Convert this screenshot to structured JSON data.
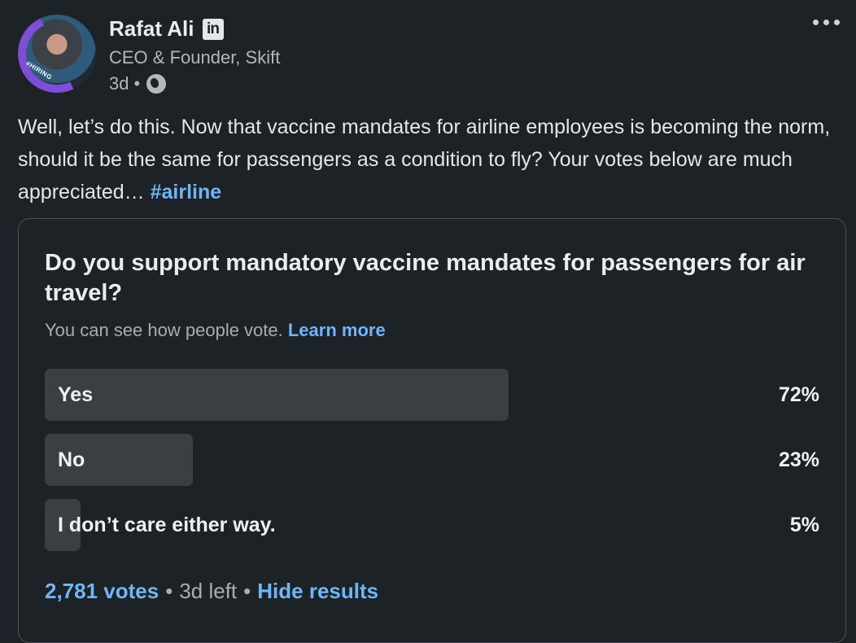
{
  "author": {
    "name": "Rafat Ali",
    "badge": "in",
    "headline": "CEO & Founder, Skift",
    "time": "3d",
    "dot": "•",
    "avatar_tag": "#HIRING"
  },
  "post": {
    "text": "Well, let’s do this. Now that vaccine mandates for airline employees is becoming the norm, should it be the same for passengers as a condition to fly? Your votes below are much appreciated… ",
    "hashtag": "#airline"
  },
  "poll": {
    "question": "Do you support mandatory vaccine mandates for passengers for air travel?",
    "notice": "You can see how people vote. ",
    "learn_more": "Learn more",
    "options": [
      {
        "label": "Yes",
        "percent": "72%",
        "fraction": 0.72
      },
      {
        "label": "No",
        "percent": "23%",
        "fraction": 0.23
      },
      {
        "label": "I don’t care either way.",
        "percent": "5%",
        "fraction": 0.05
      }
    ],
    "votes": "2,781 votes",
    "time_left": "3d left",
    "hide_results": "Hide results",
    "sep": "•"
  },
  "colors": {
    "background": "#1d2226",
    "link": "#70b5f9",
    "bar": "#3a3f44"
  }
}
